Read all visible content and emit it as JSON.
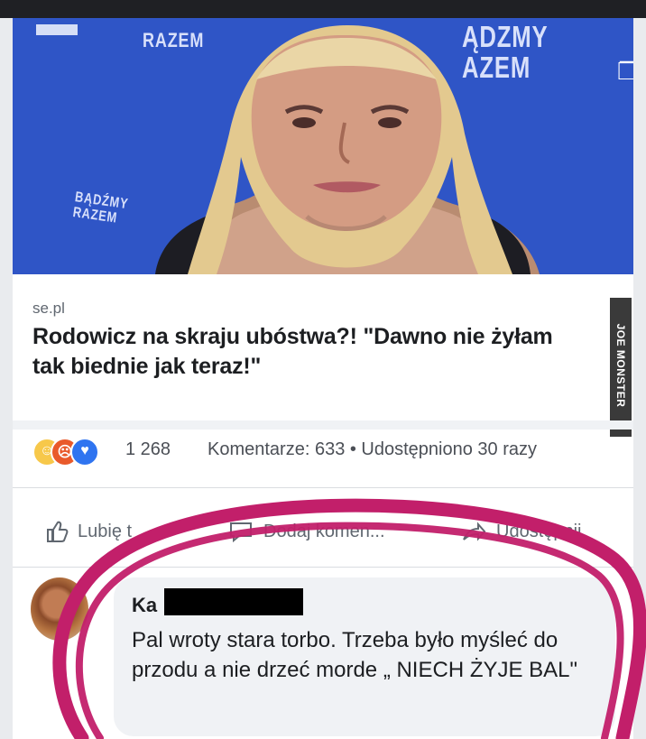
{
  "backdrop": {
    "razem_text": "RAZEM",
    "budzmy_top": "ĄDZMY\nAZEM",
    "budzmy_bottom": "BĄDŹMY\nRAZEM"
  },
  "post": {
    "source": "se.pl",
    "title": "Rodowicz na skraju ubóstwa?! \"Dawno nie żyłam tak biednie jak teraz!\"",
    "watermark": "JOE MONSTER",
    "reaction_count": "1 268",
    "comments_shares": "Komentarze: 633 • Udostępniono 30 razy"
  },
  "actions": {
    "like": "Lubię t",
    "comment": "Dodaj komen...",
    "share": "Udostępnij"
  },
  "comment": {
    "author_visible": "Ka",
    "text": "Pal wroty stara torbo. Trzeba było myśleć do przodu a nie drzeć morde „ NIECH ŻYJE BAL\""
  },
  "colors": {
    "hero_blue": "#2f55c6",
    "highlight_ring": "#c21f6a",
    "link_gray": "#606770"
  },
  "icons": [
    "like-icon",
    "comment-icon",
    "share-icon",
    "haha-reaction-icon",
    "angry-reaction-icon",
    "like-reaction-icon",
    "expand-icon"
  ]
}
